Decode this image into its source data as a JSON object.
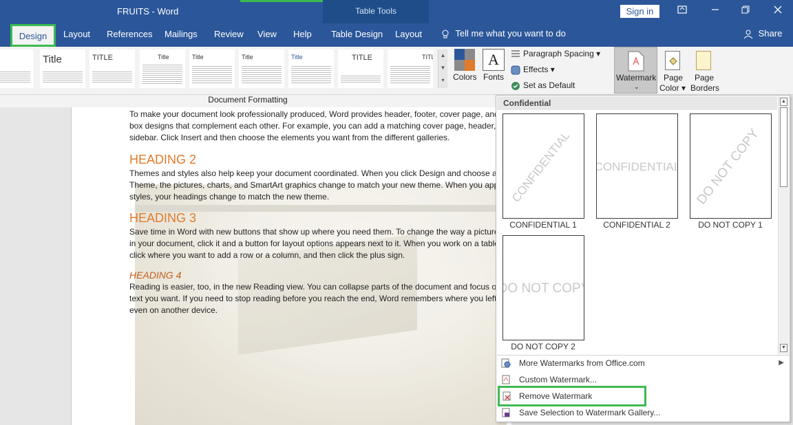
{
  "window": {
    "title": "FRUITS  -  Word",
    "tool_context": "Table Tools",
    "sign_in": "Sign in"
  },
  "tabs": [
    {
      "label": "Design",
      "active": true
    },
    {
      "label": "Layout"
    },
    {
      "label": "References"
    },
    {
      "label": "Mailings"
    },
    {
      "label": "Review"
    },
    {
      "label": "View"
    },
    {
      "label": "Help"
    },
    {
      "label": "Table Design"
    },
    {
      "label": "Layout"
    }
  ],
  "tell_me": "Tell me what you want to do",
  "share": "Share",
  "ribbon": {
    "themes": [
      {
        "title": "Title"
      },
      {
        "title": "Title"
      },
      {
        "title": "TITLE"
      },
      {
        "title": "Title"
      },
      {
        "title": "Title"
      },
      {
        "title": "Title"
      },
      {
        "title": "Title"
      },
      {
        "title": "TITLE"
      },
      {
        "title": "TITLE"
      }
    ],
    "colors_label": "Colors",
    "fonts_label": "Fonts",
    "fonts_glyph": "A",
    "paragraph_spacing": "Paragraph Spacing",
    "effects": "Effects",
    "set_as_default": "Set as Default",
    "watermark": "Watermark",
    "page_color": [
      "Page",
      "Color"
    ],
    "page_borders": [
      "Page",
      "Borders"
    ],
    "group_label": "Document Formatting",
    "accent_colors": {
      "blue": "#2b579a",
      "orange": "#e07a2c",
      "gray": "#8a8a8a",
      "green": "#3dba4e"
    }
  },
  "document": {
    "para1": "To make your document look professionally produced, Word provides header, footer, cover page, and text box designs that complement each other. For example, you can add a matching cover page, header, and sidebar. Click Insert and then choose the elements you want from the different galleries.",
    "heading2": "HEADING 2",
    "para2": "Themes and styles also help keep your document coordinated. When you click Design and choose a new Theme, the pictures, charts, and SmartArt graphics change to match your new theme. When you apply styles, your headings change to match the new theme.",
    "heading3": "HEADING 3",
    "para3": "Save time in Word with new buttons that show up where you need them. To change the way a picture fits in your document, click it and a button for layout options appears next to it. When you work on a table, click where you want to add a row or a column, and then click the plus sign.",
    "heading4": "HEADING 4",
    "para4": "Reading is easier, too, in the new Reading view. You can collapse parts of the document and focus on the text you want. If you need to stop reading before you reach the end, Word remembers where you left off - even on another device."
  },
  "watermark_menu": {
    "section": "Confidential",
    "items": [
      {
        "label": "CONFIDENTIAL 1",
        "text": "CONFIDENTIAL",
        "diagonal": true
      },
      {
        "label": "CONFIDENTIAL 2",
        "text": "CONFIDENTIAL",
        "diagonal": false
      },
      {
        "label": "DO NOT COPY 1",
        "text": "DO NOT COPY",
        "diagonal": true
      },
      {
        "label": "DO NOT COPY 2",
        "text": "DO NOT COPY",
        "diagonal": false
      }
    ],
    "actions": {
      "more": "More Watermarks from Office.com",
      "custom": "Custom Watermark...",
      "remove": "Remove Watermark",
      "save": "Save Selection to Watermark Gallery..."
    }
  }
}
